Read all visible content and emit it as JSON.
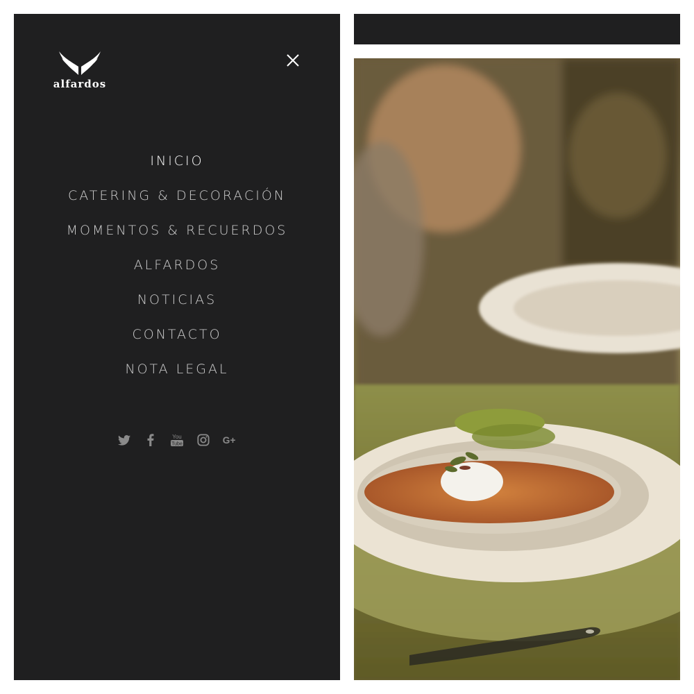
{
  "brand": {
    "name": "alfardos",
    "logo_icon": "wings-icon"
  },
  "menu": {
    "close_icon": "close-icon",
    "items": [
      {
        "label": "INICIO",
        "active": true
      },
      {
        "label": "CATERING & DECORACIÓN",
        "active": false
      },
      {
        "label": "MOMENTOS & RECUERDOS",
        "active": false
      },
      {
        "label": "ALFARDOS",
        "active": false
      },
      {
        "label": "NOTICIAS",
        "active": false
      },
      {
        "label": "CONTACTO",
        "active": false
      },
      {
        "label": "NOTA LEGAL",
        "active": false
      }
    ]
  },
  "social": {
    "icons": [
      "twitter-icon",
      "facebook-icon",
      "youtube-icon",
      "instagram-icon",
      "google-plus-icon"
    ],
    "youtube_text_top": "You",
    "youtube_text_bottom": "Tube",
    "google_plus_text": "G+"
  },
  "colors": {
    "panel": "#1f1f20",
    "active_text": "#ffffff",
    "inactive_text": "#cfcfcf",
    "social_icon": "#8a8a8a"
  },
  "photo": {
    "subject": "plated-soup-dish"
  }
}
